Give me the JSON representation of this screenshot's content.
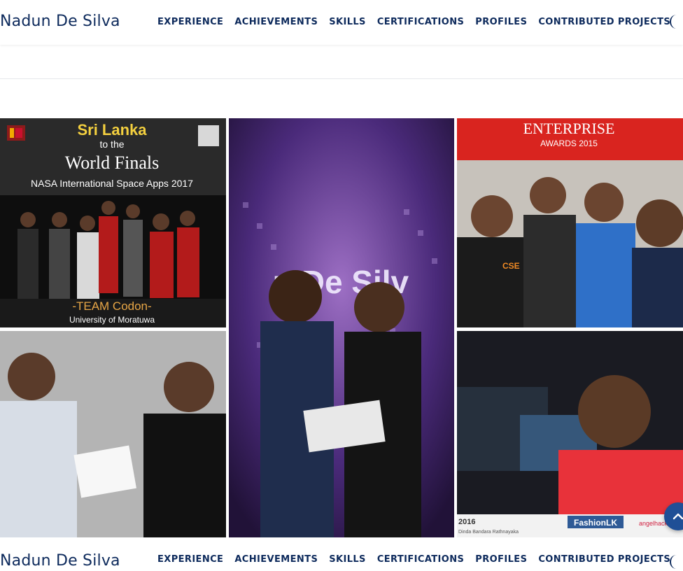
{
  "header": {
    "brand": "Nadun De Silva",
    "menu": [
      "EXPERIENCE",
      "ACHIEVEMENTS",
      "SKILLS",
      "CERTIFICATIONS",
      "PROFILES",
      "CONTRIBUTED PROJECTS"
    ],
    "theme_icon": "moon-icon"
  },
  "gallery": {
    "photo1": {
      "title": "Sri Lanka",
      "subtitle": "to the",
      "heading": "World Finals",
      "event": "NASA International Space Apps 2017",
      "team": "-TEAM Codon-",
      "university": "University of Moratuwa"
    },
    "photo2": {
      "banner": "u De Silv"
    },
    "photo3": {
      "banner": "ENTERPRISE",
      "sub": "AWARDS 2015",
      "shirt": "CSE"
    },
    "photo4": {},
    "photo5": {
      "logo": "FashionLK",
      "year": "2016",
      "credit": "Dinda Bandara Rathnayaka",
      "brand": "angelhack"
    }
  },
  "footer_nav": {
    "brand": "Nadun De Silva",
    "menu": [
      "EXPERIENCE",
      "ACHIEVEMENTS",
      "SKILLS",
      "CERTIFICATIONS",
      "PROFILES",
      "CONTRIBUTED PROJECTS"
    ]
  },
  "scroll_top_icon": "chevron-up-icon",
  "colors": {
    "brand": "#0d2a5c",
    "accent": "#1f4f96"
  }
}
